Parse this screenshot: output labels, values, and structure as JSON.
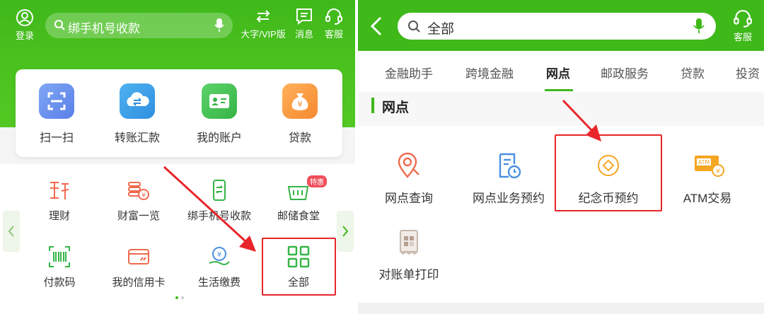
{
  "left": {
    "header": {
      "login_label": "登录",
      "search_placeholder": "绑手机号收款",
      "vip_label": "大字/VIP版",
      "message_label": "消息",
      "service_label": "客服"
    },
    "quick_actions": [
      {
        "label": "扫一扫",
        "icon": "scan-icon"
      },
      {
        "label": "转账汇款",
        "icon": "transfer-cloud-icon"
      },
      {
        "label": "我的账户",
        "icon": "account-card-icon"
      },
      {
        "label": "贷款",
        "icon": "money-bag-icon"
      }
    ],
    "grid": [
      {
        "label": "理财",
        "icon": "wealth-icon"
      },
      {
        "label": "财富一览",
        "icon": "coins-icon"
      },
      {
        "label": "绑手机号收款",
        "icon": "phone-receive-icon"
      },
      {
        "label": "邮储食堂",
        "icon": "canteen-icon",
        "badge": "特惠"
      },
      {
        "label": "付款码",
        "icon": "barcode-icon"
      },
      {
        "label": "我的信用卡",
        "icon": "credit-card-icon"
      },
      {
        "label": "生活缴费",
        "icon": "bill-pay-icon"
      },
      {
        "label": "全部",
        "icon": "all-grid-icon"
      }
    ],
    "page_indicator": {
      "current": 1,
      "total": 2
    }
  },
  "right": {
    "header": {
      "search_value": "全部",
      "service_label": "客服"
    },
    "tabs": [
      "金融助手",
      "跨境金融",
      "网点",
      "邮政服务",
      "贷款",
      "投资"
    ],
    "active_tab": "网点",
    "section_title": "网点",
    "items": [
      {
        "label": "网点查询",
        "icon": "location-search-icon"
      },
      {
        "label": "网点业务预约",
        "icon": "appointment-doc-icon"
      },
      {
        "label": "纪念币预约",
        "icon": "commemorative-coin-icon"
      },
      {
        "label": "ATM交易",
        "icon": "atm-icon",
        "icon_text": "ATM"
      },
      {
        "label": "对账单打印",
        "icon": "statement-print-icon"
      }
    ]
  },
  "colors": {
    "brand_green": "#3fb81a",
    "annotation_red": "#e8252a",
    "icon_red": "#ef6a4e",
    "icon_blue": "#4a90e2",
    "icon_orange": "#f5a623"
  }
}
